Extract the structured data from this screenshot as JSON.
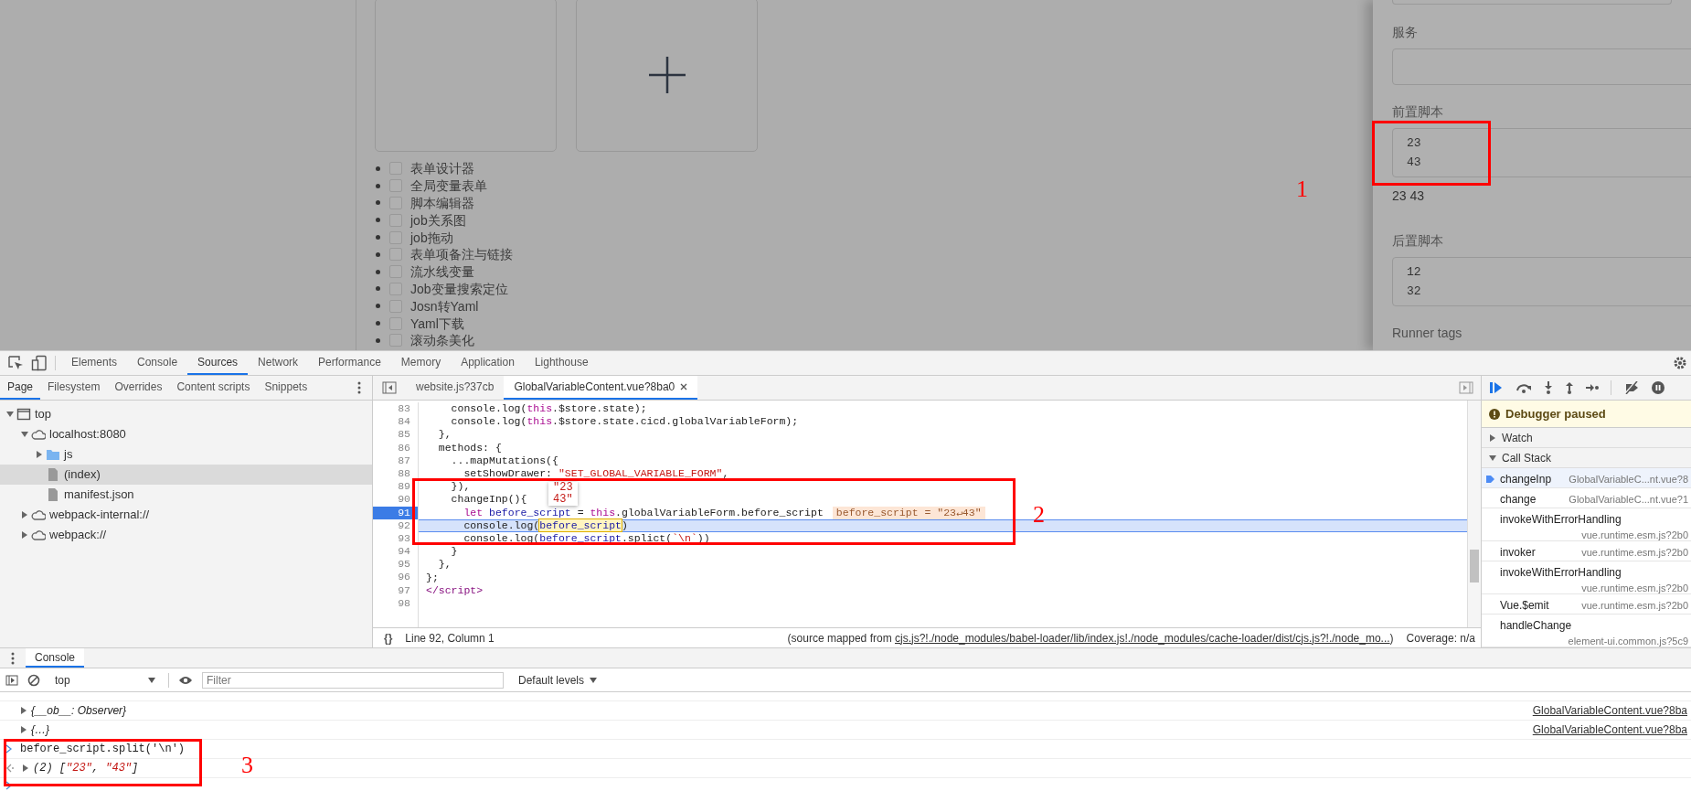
{
  "page": {
    "checklist": [
      {
        "label": "表单设计器",
        "checked": false
      },
      {
        "label": "全局变量表单",
        "checked": false
      },
      {
        "label": "脚本编辑器",
        "checked": false
      },
      {
        "label": "job关系图",
        "checked": false
      },
      {
        "label": "job拖动",
        "checked": false
      },
      {
        "label": "表单项备注与链接",
        "checked": false
      },
      {
        "label": "流水线变量",
        "checked": false
      },
      {
        "label": "Job变量搜索定位",
        "checked": false
      },
      {
        "label": "Josn转Yaml",
        "checked": false
      },
      {
        "label": "Yaml下载",
        "checked": false
      },
      {
        "label": "滚动条美化",
        "checked": false
      }
    ],
    "drawer": [
      {
        "kind": "input",
        "label": "服务"
      },
      {
        "kind": "textarea",
        "label": "前置脚本",
        "value": "23\n43",
        "echo": "23 43"
      },
      {
        "kind": "textarea",
        "label": "后置脚本",
        "value": "12\n32"
      },
      {
        "kind": "heading",
        "label": "Runner tags"
      }
    ]
  },
  "devtools": {
    "tabs": [
      {
        "label": "Elements",
        "selected": false
      },
      {
        "label": "Console",
        "selected": false
      },
      {
        "label": "Sources",
        "selected": true
      },
      {
        "label": "Network",
        "selected": false
      },
      {
        "label": "Performance",
        "selected": false
      },
      {
        "label": "Memory",
        "selected": false
      },
      {
        "label": "Application",
        "selected": false
      },
      {
        "label": "Lighthouse",
        "selected": false
      }
    ],
    "navigator_tabs": [
      {
        "label": "Page",
        "selected": true
      },
      {
        "label": "Filesystem",
        "selected": false
      },
      {
        "label": "Overrides",
        "selected": false
      },
      {
        "label": "Content scripts",
        "selected": false
      },
      {
        "label": "Snippets",
        "selected": false
      }
    ],
    "tree": [
      {
        "label": "top",
        "kind": "frame",
        "expanded": true,
        "selected": false,
        "children": [
          {
            "label": "localhost:8080",
            "kind": "cloud",
            "expanded": true,
            "selected": false,
            "children": [
              {
                "label": "js",
                "kind": "folder",
                "expanded": false,
                "selected": false
              },
              {
                "label": "(index)",
                "kind": "file",
                "selected": true
              },
              {
                "label": "manifest.json",
                "kind": "file",
                "selected": false
              }
            ]
          },
          {
            "label": "webpack-internal://",
            "kind": "cloud",
            "expanded": false,
            "selected": false
          },
          {
            "label": "webpack://",
            "kind": "cloud",
            "expanded": false,
            "selected": false
          }
        ]
      }
    ],
    "editor_tabs": [
      {
        "label": "website.js?37cb",
        "selected": false
      },
      {
        "label": "GlobalVariableContent.vue?8ba0",
        "selected": true
      }
    ],
    "code": [
      {
        "number": "83",
        "breakpoint": false,
        "current": false,
        "tokens": [
          {
            "text": "    console.log(",
            "kind": "plain"
          },
          {
            "text": "this",
            "kind": "keyword"
          },
          {
            "text": ".$store.state);",
            "kind": "plain"
          }
        ]
      },
      {
        "number": "84",
        "breakpoint": false,
        "current": false,
        "tokens": [
          {
            "text": "    console.log(",
            "kind": "plain"
          },
          {
            "text": "this",
            "kind": "keyword"
          },
          {
            "text": ".$store.state.cicd.globalVariableForm);",
            "kind": "plain"
          }
        ]
      },
      {
        "number": "85",
        "breakpoint": false,
        "current": false,
        "tokens": [
          {
            "text": "  },",
            "kind": "plain"
          }
        ]
      },
      {
        "number": "86",
        "breakpoint": false,
        "current": false,
        "tokens": [
          {
            "text": "  methods: {",
            "kind": "plain"
          }
        ]
      },
      {
        "number": "87",
        "breakpoint": false,
        "current": false,
        "tokens": [
          {
            "text": "    ...mapMutations({",
            "kind": "plain"
          }
        ]
      },
      {
        "number": "88",
        "breakpoint": false,
        "current": false,
        "tokens": [
          {
            "text": "      setShowDrawer: ",
            "kind": "plain"
          },
          {
            "text": "\"SET_GLOBAL_VARIABLE_FORM\"",
            "kind": "string"
          },
          {
            "text": ",",
            "kind": "plain"
          }
        ]
      },
      {
        "number": "89",
        "breakpoint": false,
        "current": false,
        "tokens": [
          {
            "text": "    }),",
            "kind": "plain"
          }
        ]
      },
      {
        "number": "90",
        "breakpoint": false,
        "current": false,
        "tokens": [
          {
            "text": "    changeInp(){",
            "kind": "plain"
          }
        ]
      },
      {
        "number": "91",
        "breakpoint": true,
        "current": false,
        "tokens": [
          {
            "text": "      let",
            "kind": "keyword"
          },
          {
            "text": " before_script",
            "kind": "variable"
          },
          {
            "text": " = ",
            "kind": "plain"
          },
          {
            "text": "this",
            "kind": "keyword"
          },
          {
            "text": ".globalVariableForm.before_script",
            "kind": "plain"
          }
        ],
        "inline_value": "before_script = \"23↵43\""
      },
      {
        "number": "92",
        "breakpoint": false,
        "current": true,
        "tokens": [
          {
            "text": "      console.log(",
            "kind": "plain"
          },
          {
            "text": "before_script",
            "kind": "hover"
          },
          {
            "text": ")",
            "kind": "plain"
          }
        ]
      },
      {
        "number": "93",
        "breakpoint": false,
        "current": false,
        "tokens": [
          {
            "text": "      console.log(",
            "kind": "plain"
          },
          {
            "text": "before_script",
            "kind": "variable"
          },
          {
            "text": ".splict(",
            "kind": "plain"
          },
          {
            "text": "`\\n`",
            "kind": "string"
          },
          {
            "text": "))",
            "kind": "plain"
          }
        ]
      },
      {
        "number": "94",
        "breakpoint": false,
        "current": false,
        "tokens": [
          {
            "text": "    }",
            "kind": "plain"
          }
        ]
      },
      {
        "number": "95",
        "breakpoint": false,
        "current": false,
        "tokens": [
          {
            "text": "  },",
            "kind": "plain"
          }
        ]
      },
      {
        "number": "96",
        "breakpoint": false,
        "current": false,
        "tokens": [
          {
            "text": "};",
            "kind": "plain"
          }
        ]
      },
      {
        "number": "97",
        "breakpoint": false,
        "current": false,
        "tokens": [
          {
            "text": "</script>",
            "kind": "tag"
          }
        ]
      },
      {
        "number": "98",
        "breakpoint": false,
        "current": false
      }
    ],
    "value_tooltip": "\"23\n43\"",
    "status": {
      "pretty_print": "{}",
      "position": "Line 92, Column 1",
      "source_before": "(source mapped from ",
      "source_link": "cjs.js?!./node_modules/babel-loader/lib/index.js!./node_modules/cache-loader/dist/cjs.js?!./node_mo...",
      "source_after": ")",
      "coverage": "Coverage: n/a"
    },
    "debugger": {
      "banner": "Debugger paused",
      "sections": [
        {
          "label": "Watch",
          "expanded": false
        },
        {
          "label": "Call Stack",
          "expanded": true
        }
      ],
      "call_stack": [
        {
          "name": "changeInp",
          "location": "GlobalVariableC...nt.vue?8",
          "selected": true
        },
        {
          "name": "change",
          "location": "GlobalVariableC...nt.vue?1",
          "selected": false
        },
        {
          "name": "invokeWithErrorHandling",
          "location": "vue.runtime.esm.js?2b0",
          "selected": false
        },
        {
          "name": "invoker",
          "location": "vue.runtime.esm.js?2b0",
          "selected": false
        },
        {
          "name": "invokeWithErrorHandling",
          "location": "vue.runtime.esm.js?2b0",
          "selected": false
        },
        {
          "name": "Vue.$emit",
          "location": "vue.runtime.esm.js?2b0",
          "selected": false
        },
        {
          "name": "handleChange",
          "location": "element-ui.common.js?5c9",
          "selected": false
        }
      ]
    },
    "console": {
      "tab": "Console",
      "context": "top",
      "filter_placeholder": "Filter",
      "levels": "Default levels",
      "messages": [
        {
          "kind": "object",
          "text": "{__ob__: Observer}",
          "source": "GlobalVariableContent.vue?8ba"
        },
        {
          "kind": "object",
          "text": "{…}",
          "source": "GlobalVariableContent.vue?8ba"
        },
        {
          "kind": "input",
          "text": "before_script.split('\\n')"
        },
        {
          "kind": "result",
          "tokens": [
            {
              "text": "(2) [",
              "kind": "plain"
            },
            {
              "text": "\"23\"",
              "kind": "string"
            },
            {
              "text": ", ",
              "kind": "plain"
            },
            {
              "text": "\"43\"",
              "kind": "string"
            },
            {
              "text": "]",
              "kind": "plain"
            }
          ]
        }
      ]
    }
  },
  "annotations": [
    {
      "label": "1"
    },
    {
      "label": "2"
    },
    {
      "label": "3"
    }
  ]
}
